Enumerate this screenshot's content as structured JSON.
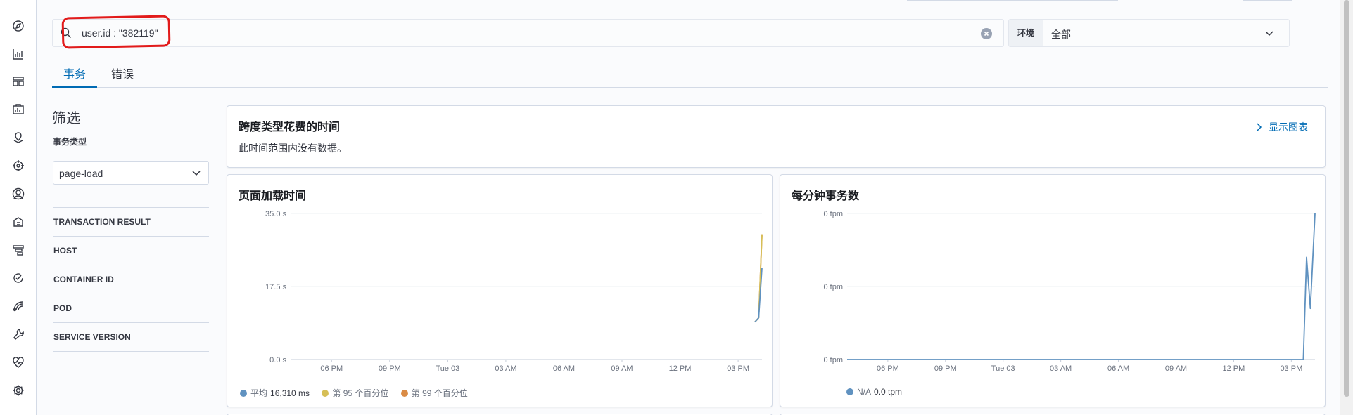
{
  "search": {
    "query": "user.id : \"382119\""
  },
  "environment": {
    "label": "环境",
    "value": "全部"
  },
  "tabs": [
    {
      "label": "事务",
      "active": true
    },
    {
      "label": "错误",
      "active": false
    }
  ],
  "filters": {
    "title": "筛选",
    "type_label": "事务类型",
    "type_value": "page-load",
    "facets": [
      "TRANSACTION RESULT",
      "HOST",
      "CONTAINER ID",
      "POD",
      "SERVICE VERSION"
    ]
  },
  "span_panel": {
    "title": "跨度类型花费的时间",
    "message": "此时间范围内没有数据。",
    "show_chart_label": "显示图表"
  },
  "load_panel": {
    "title": "页面加载时间",
    "legend": [
      {
        "label": "平均",
        "value": "16,310 ms",
        "color": "#6092c0"
      },
      {
        "label": "第 95 个百分位",
        "value": "",
        "color": "#d6bf57"
      },
      {
        "label": "第 99 个百分位",
        "value": "",
        "color": "#da8b45"
      }
    ]
  },
  "tpm_panel": {
    "title": "每分钟事务数",
    "legend": [
      {
        "label": "N/A",
        "value": "0.0 tpm",
        "color": "#6092c0"
      }
    ]
  },
  "chart_data": [
    {
      "type": "line",
      "title": "页面加载时间",
      "x_ticks": [
        "06 PM",
        "09 PM",
        "Tue 03",
        "03 AM",
        "06 AM",
        "09 AM",
        "12 PM",
        "03 PM"
      ],
      "y_ticks": [
        "0.0 s",
        "17.5 s",
        "35.0 s"
      ],
      "ylim": [
        0,
        35
      ],
      "grid": true,
      "legend_position": "bottom",
      "series": [
        {
          "name": "平均",
          "color": "#6092c0",
          "points": [
            [
              0.985,
              9
            ],
            [
              0.993,
              10
            ],
            [
              1.0,
              22
            ]
          ]
        },
        {
          "name": "第 95 个百分位",
          "color": "#d6bf57",
          "points": [
            [
              0.985,
              9
            ],
            [
              0.993,
              10
            ],
            [
              1.0,
              30
            ]
          ]
        },
        {
          "name": "第 99 个百分位",
          "color": "#da8b45",
          "points": [
            [
              0.985,
              9
            ],
            [
              0.993,
              10
            ],
            [
              1.0,
              30
            ]
          ]
        }
      ]
    },
    {
      "type": "line",
      "title": "每分钟事务数",
      "x_ticks": [
        "06 PM",
        "09 PM",
        "Tue 03",
        "03 AM",
        "06 AM",
        "09 AM",
        "12 PM",
        "03 PM"
      ],
      "y_ticks": [
        "0 tpm",
        "0 tpm",
        "0 tpm"
      ],
      "ylim": [
        0,
        1
      ],
      "grid": true,
      "legend_position": "bottom",
      "series": [
        {
          "name": "N/A",
          "color": "#6092c0",
          "points": [
            [
              0.0,
              0
            ],
            [
              0.975,
              0
            ],
            [
              0.982,
              0.7
            ],
            [
              0.99,
              0.35
            ],
            [
              1.0,
              1.0
            ]
          ]
        }
      ]
    }
  ]
}
